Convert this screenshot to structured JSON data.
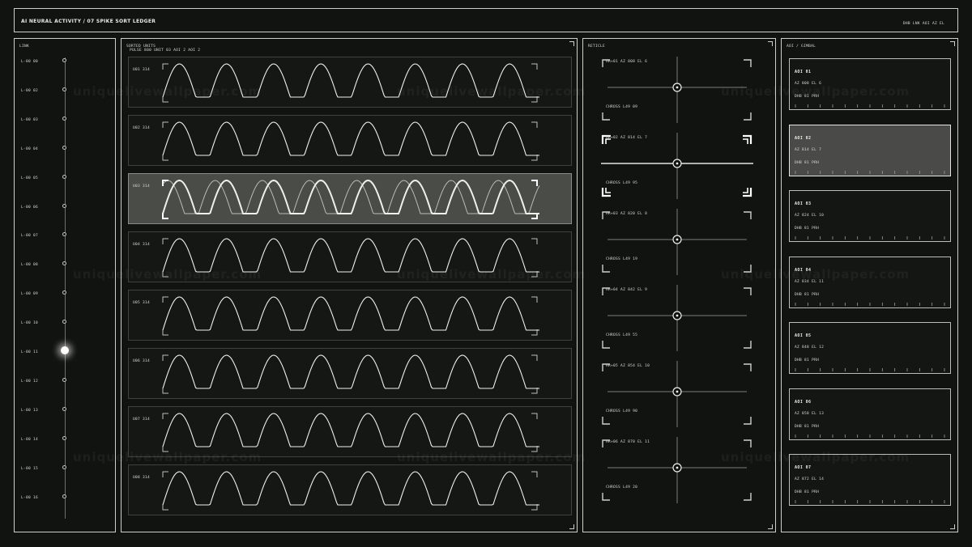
{
  "header": {
    "title": "AI NEURAL ACTIVITY  /  07  SPIKE SORT LEDGER",
    "meta": "DHB  LNK  AOI  AZ  EL"
  },
  "link": {
    "title": "LINK",
    "items": [
      "L-00 00",
      "L-00 02",
      "L-00 03",
      "L-00 04",
      "L-00 05",
      "L-00 06",
      "L-00 07",
      "L-00 08",
      "L-00 09",
      "L-00 10",
      "L-00 11",
      "L-00 12",
      "L-00 13",
      "L-00 14",
      "L-00 15",
      "L-00 16"
    ],
    "active_index": 9
  },
  "sorted": {
    "title": "SORTED UNITS",
    "subtitle": "PULSE 800  UNIT 03  AOI 2  AOI 2",
    "units": [
      "U01 314",
      "U02 314",
      "U03 314",
      "U04 314",
      "U05 314",
      "U06 314",
      "U07 314",
      "U08 314"
    ],
    "active_index": 2
  },
  "reticle": {
    "title": "RETICLE",
    "cells": [
      {
        "top": "HR+01  AZ 808  EL 6",
        "bottom": "CHROSS  L49 09"
      },
      {
        "top": "HR+02  AZ 814  EL 7",
        "bottom": "CHROSS  L49 95"
      },
      {
        "top": "HR+03  AZ 820  EL 8",
        "bottom": "CHROSS  L49 19"
      },
      {
        "top": "HR+04  AZ 842  EL 9",
        "bottom": "CHROSS  L49 55"
      },
      {
        "top": "HR+05  AZ 854  EL 10",
        "bottom": "CHROSS  L49 90"
      },
      {
        "top": "HR+06  AZ 870  EL 11",
        "bottom": "CHROSS  L49 20"
      }
    ],
    "active_index": 1
  },
  "aoi": {
    "title": "AOI / GIMBAL",
    "cards": [
      {
        "id": "AOI 01",
        "line2": "AZ 808  EL 6",
        "line3": "DHB 81  PRH"
      },
      {
        "id": "AOI 02",
        "line2": "AZ 814  EL 7",
        "line3": "DHB 81  PRH"
      },
      {
        "id": "AOI 03",
        "line2": "AZ 824  EL 10",
        "line3": "DHB 81  PRH"
      },
      {
        "id": "AOI 04",
        "line2": "AZ 834  EL 11",
        "line3": "DHB 81  PRH"
      },
      {
        "id": "AOI 05",
        "line2": "AZ 848  EL 12",
        "line3": "DHB 81  PRH"
      },
      {
        "id": "AOI 06",
        "line2": "AZ 858  EL 13",
        "line3": "DHB 81  PRH"
      },
      {
        "id": "AOI 07",
        "line2": "AZ 872  EL 14",
        "line3": "DHB 81  PRH"
      }
    ],
    "active_index": 1
  },
  "watermark": "uniquelivewallpaper.com"
}
